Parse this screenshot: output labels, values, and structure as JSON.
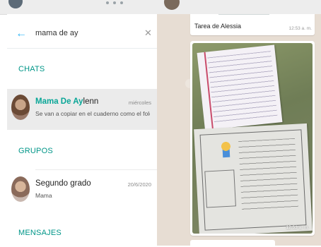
{
  "search": {
    "query": "mama de ay"
  },
  "sections": {
    "chats": "CHATS",
    "groups": "GRUPOS",
    "messages": "MENSAJES"
  },
  "chats": [
    {
      "name_highlight": "Mama De Ay",
      "name_rest": "lenn",
      "date": "miércoles",
      "preview": "Se van a copiar en el cuaderno como el folder ..."
    }
  ],
  "groups": [
    {
      "name": "Segundo grado",
      "date": "20/6/2020",
      "preview": "Mama"
    }
  ],
  "conversation": {
    "caption": "Tarea de Alessia",
    "caption_time": "12:53 a. m.",
    "photo_time": "12:53 a. m."
  },
  "colors": {
    "accent_teal": "#009688",
    "highlight": "#09a697",
    "back_arrow": "#33b7f6",
    "chat_bg": "#e7ddd3"
  },
  "icons": {
    "back": "arrow-left-icon",
    "clear": "close-icon"
  }
}
